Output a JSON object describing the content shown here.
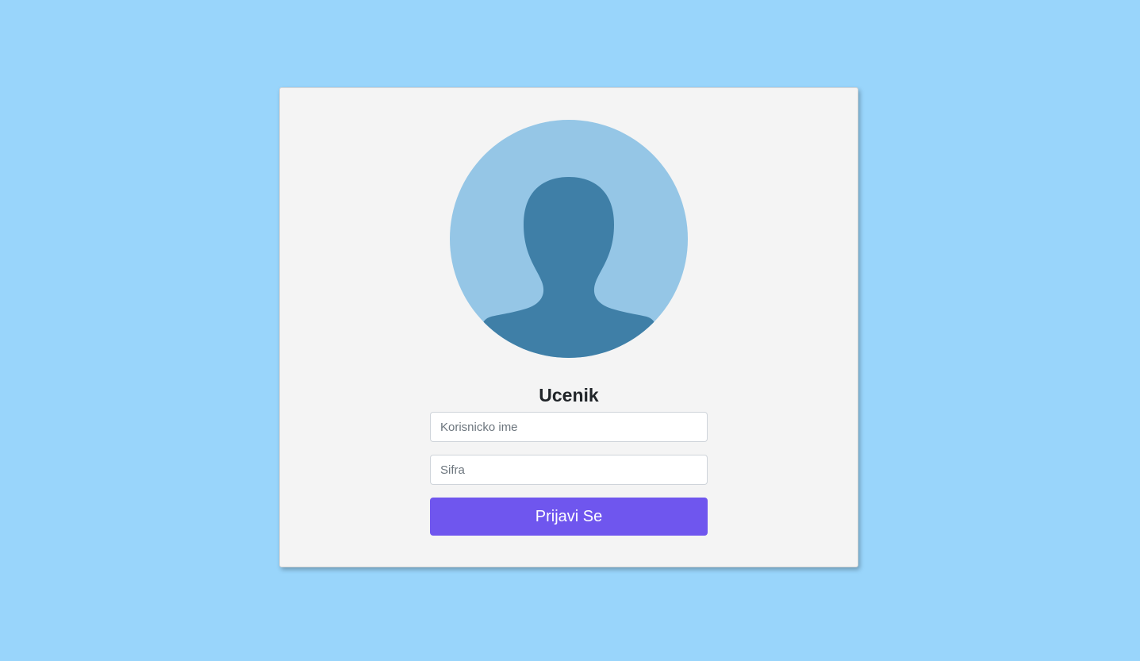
{
  "login": {
    "avatar_icon": "user-silhouette-icon",
    "title": "Ucenik",
    "username": {
      "placeholder": "Korisnicko ime",
      "value": ""
    },
    "password": {
      "placeholder": "Sifra",
      "value": ""
    },
    "submit_label": "Prijavi Se"
  },
  "colors": {
    "background": "#99d5fb",
    "card": "#f4f4f4",
    "avatar_circle": "#95c6e6",
    "avatar_silhouette": "#3f7fa7",
    "button": "#6f56ee"
  }
}
